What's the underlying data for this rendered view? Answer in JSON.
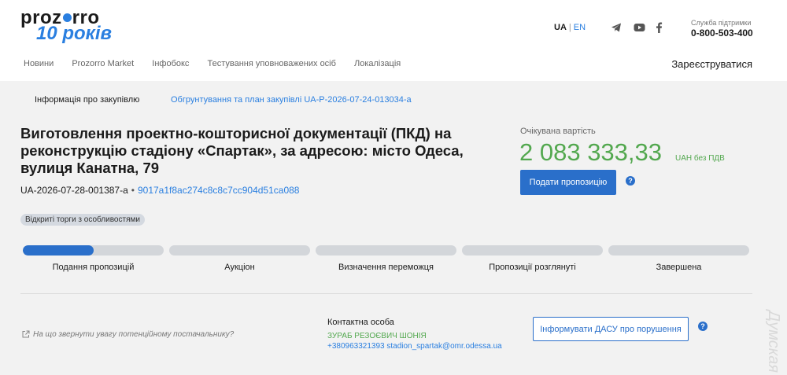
{
  "header": {
    "logo_top": "proz",
    "logo_top_end": "rro",
    "logo_bottom": "10 років",
    "lang_current": "UA",
    "lang_sep": "|",
    "lang_alt": "EN",
    "social_icons": [
      "telegram-icon",
      "youtube-icon",
      "facebook-icon"
    ],
    "support_label": "Служба підтримки",
    "support_phone": "0-800-503-400",
    "nav": [
      "Новини",
      "Prozorro Market",
      "Інфобокс",
      "Тестування уповноважених осіб",
      "Локалізація"
    ],
    "register": "Зареєструватися"
  },
  "tabs": {
    "active": "Інформація про закупівлю",
    "link": "Обгрунтування та план закупівлі UA-P-2026-07-24-013034-a"
  },
  "tender": {
    "title": "Виготовлення проектно-кошторисної документації (ПКД) на реконструкцію стадіону «Спартак», за адресою: місто Одеса, вулиця Канатна, 79",
    "id": "UA-2026-07-28-001387-a",
    "bullet": "•",
    "hash": "9017a1f8ac274c8c8c7cc904d51ca088",
    "badge": "Відкриті торги з особливостями",
    "expected_label": "Очікувана вартість",
    "expected_value": "2 083 333,33",
    "expected_unit": "UAH без ПДВ",
    "submit_button": "Подати пропозицію",
    "help_glyph": "?"
  },
  "stages": [
    {
      "label": "Подання пропозицій",
      "progress": 0.5
    },
    {
      "label": "Аукціон",
      "progress": 0
    },
    {
      "label": "Визначення переможця",
      "progress": 0
    },
    {
      "label": "Пропозиції розглянуті",
      "progress": 0
    },
    {
      "label": "Завершена",
      "progress": 0
    }
  ],
  "footer": {
    "attention": "На що звернути увагу потенційному постачальнику?",
    "contact_title": "Контактна особа",
    "contact_name": "ЗУРАБ РЕЗОЄВИЧ ШОНІЯ",
    "contact_line": "+380963321393 stadion_spartak@omr.odessa.ua",
    "dasu_button": "Інформувати ДАСУ про порушення"
  },
  "watermark": "Думская",
  "colors": {
    "accent": "#2a6fca",
    "link": "#2a7fe0",
    "green": "#53a84f",
    "page_bg": "#f2f2f2"
  }
}
